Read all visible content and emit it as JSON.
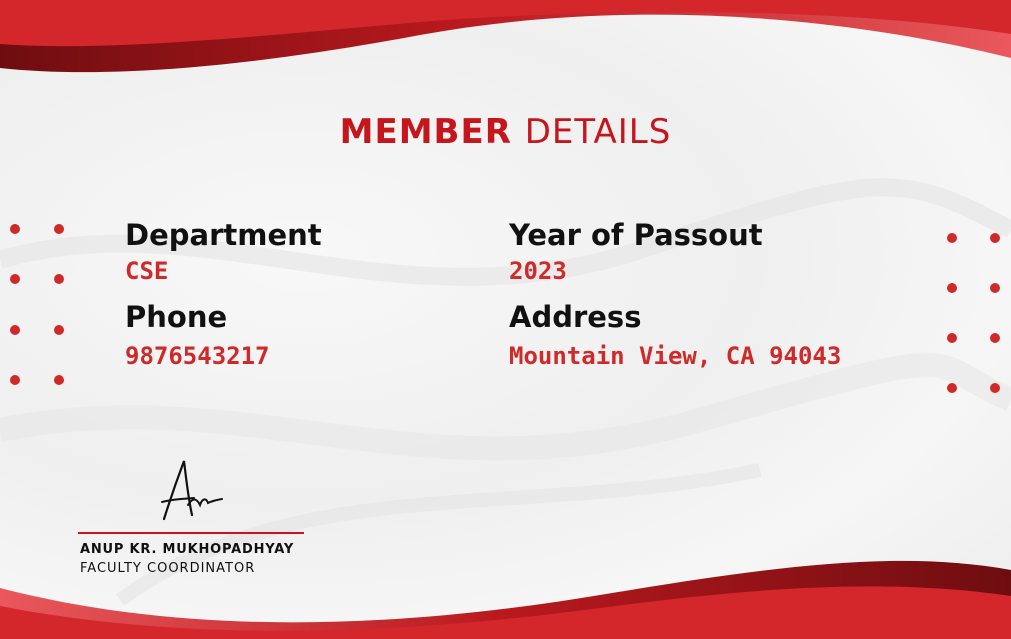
{
  "title": {
    "word1": "MEMBER",
    "word2": "DETAILS"
  },
  "fields": {
    "department": {
      "label": "Department",
      "value": "CSE"
    },
    "year": {
      "label": "Year of Passout",
      "value": "2023"
    },
    "phone": {
      "label": "Phone",
      "value": "9876543217"
    },
    "address": {
      "label": "Address",
      "value": "Mountain View, CA 94043"
    }
  },
  "signatory": {
    "name": "ANUP KR. MUKHOPADHYAY",
    "role": "FACULTY COORDINATOR"
  },
  "colors": {
    "accent": "#c4161c",
    "value_text": "#cf2a2a",
    "dark_red": "#7a0f12",
    "label_text": "#111111"
  },
  "icons": [
    "dot-pattern-left",
    "dot-pattern-right",
    "signature-icon"
  ]
}
